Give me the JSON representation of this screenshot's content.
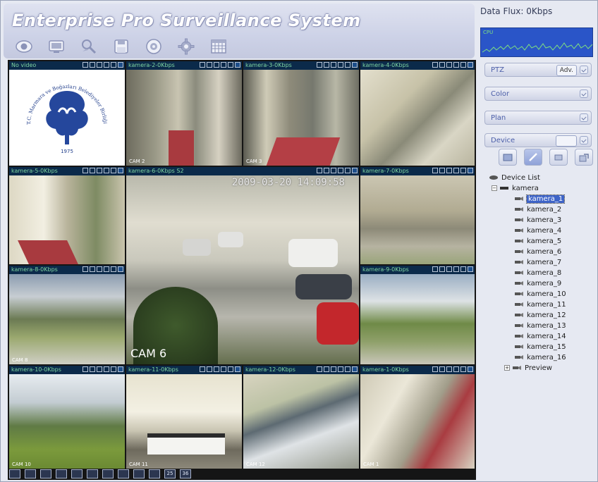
{
  "app": {
    "title": "Enterprise Pro Surveillance System"
  },
  "toolbar": {
    "buttons": [
      {
        "icon": "eye-icon"
      },
      {
        "icon": "screen-icon"
      },
      {
        "icon": "tools-icon"
      },
      {
        "icon": "save-icon"
      },
      {
        "icon": "disc-icon"
      },
      {
        "icon": "gear-icon"
      },
      {
        "icon": "calendar-icon"
      }
    ]
  },
  "grid": {
    "cells": [
      {
        "header": "No video",
        "cam": "",
        "logo": true
      },
      {
        "header": "kamera-2-0Kbps",
        "cam": "CAM 2"
      },
      {
        "header": "kamera-3-0Kbps",
        "cam": "CAM 3"
      },
      {
        "header": "kamera-4-0Kbps",
        "cam": ""
      },
      {
        "header": "kamera-5-0Kbps",
        "cam": ""
      },
      {
        "header": "kamera-6-0Kbps S2",
        "cam": "CAM 6",
        "timestamp": "2009-03-20 14:09:58"
      },
      {
        "header": "kamera-7-0Kbps",
        "cam": ""
      },
      {
        "header": "kamera-8-0Kbps",
        "cam": "CAM 8"
      },
      {
        "header": "kamera-9-0Kbps",
        "cam": ""
      },
      {
        "header": "kamera-10-0Kbps",
        "cam": "CAM 10"
      },
      {
        "header": "kamera-11-0Kbps",
        "cam": "CAM 11"
      },
      {
        "header": "kamera-12-0Kbps",
        "cam": "CAM 12"
      },
      {
        "header": "kamera-1-0Kbps",
        "cam": "CAM 1"
      }
    ],
    "logo": {
      "arc_top": "T.C. Marmara ve Boğazları Belediyeler Birliği",
      "year": "1975"
    }
  },
  "layout_bar": {
    "buttons": [
      "",
      "",
      "",
      "",
      "",
      "",
      "",
      "",
      "",
      "",
      "25",
      "36"
    ]
  },
  "right_panel": {
    "data_flux": "Data Flux: 0Kbps",
    "cpu_label": "CPU",
    "panels": {
      "ptz": "PTZ",
      "ptz_adv": "Adv.",
      "color": "Color",
      "plan": "Plan",
      "device": "Device"
    },
    "tree": {
      "root": "Device List",
      "group": "kamera",
      "items": [
        "kamera_1",
        "kamera_2",
        "kamera_3",
        "kamera_4",
        "kamera_5",
        "kamera_6",
        "kamera_7",
        "kamera_8",
        "kamera_9",
        "kamera_10",
        "kamera_11",
        "kamera_12",
        "kamera_13",
        "kamera_14",
        "kamera_15",
        "kamera_16"
      ],
      "selected": "kamera_1",
      "preview": "Preview"
    }
  },
  "colors": {
    "header_bg": "#cdd2e7",
    "cell_bar_bg": "#0b2a4a",
    "cell_bar_text": "#7fd6a2",
    "cpu_bg": "#2a55c8",
    "selection": "#3e64c8"
  }
}
